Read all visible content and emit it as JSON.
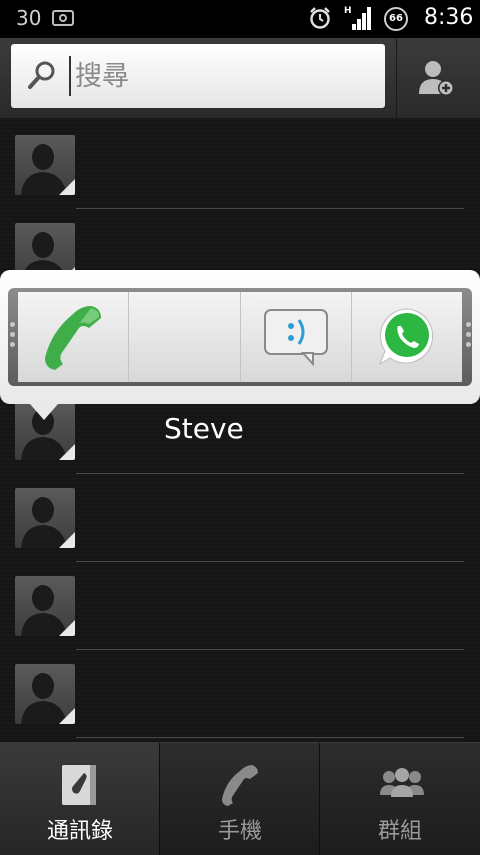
{
  "status_bar": {
    "notification_count": "30",
    "network_type": "H",
    "battery_level": "66",
    "time": "8:36"
  },
  "search": {
    "placeholder": "搜尋"
  },
  "contacts": [
    {
      "name": ""
    },
    {
      "name": ""
    },
    {
      "name": "Steve"
    },
    {
      "name": ""
    },
    {
      "name": ""
    },
    {
      "name": ""
    }
  ],
  "quick_actions": [
    {
      "icon": "phone-icon"
    },
    {
      "icon": ""
    },
    {
      "icon": "message-icon"
    },
    {
      "icon": "whatsapp-icon"
    }
  ],
  "tabs": [
    {
      "label": "通訊錄",
      "icon": "contacts-book-icon",
      "active": true
    },
    {
      "label": "手機",
      "icon": "phone-icon",
      "active": false
    },
    {
      "label": "群組",
      "icon": "group-icon",
      "active": false
    }
  ],
  "colors": {
    "phone_green": "#3fae49",
    "whatsapp_green": "#2bb741",
    "message_blue": "#2a9fd6"
  }
}
